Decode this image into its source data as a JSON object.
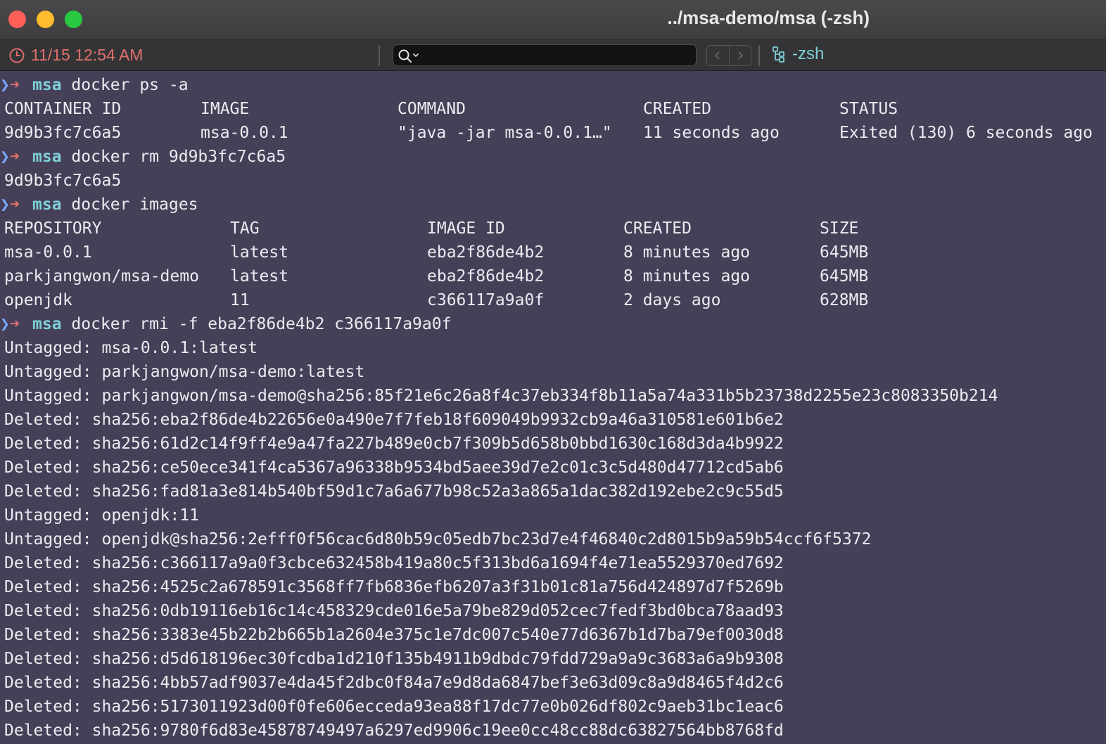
{
  "window": {
    "title": "../msa-demo/msa (-zsh)"
  },
  "toolbar": {
    "timestamp": "11/15 12:54 AM",
    "search_value": "",
    "session_label": "-zsh",
    "icons": {
      "clock": "clock-icon",
      "search": "magnifier-icon",
      "back": "chevron-left-icon",
      "forward": "chevron-right-icon",
      "session": "tree-icon"
    }
  },
  "colors": {
    "background": "#453f57",
    "prompt_dir": "#7fd0da",
    "timestamp": "#e0706c"
  },
  "terminal": {
    "prompt_dir": "msa",
    "cmd1": "docker ps -a",
    "ps_headers": [
      "CONTAINER ID",
      "IMAGE",
      "COMMAND",
      "CREATED",
      "STATUS"
    ],
    "ps_rows": [
      [
        "9d9b3fc7c6a5",
        "msa-0.0.1",
        "\"java -jar msa-0.0.1…\"",
        "11 seconds ago",
        "Exited (130) 6 seconds ago"
      ]
    ],
    "cmd2": "docker rm 9d9b3fc7c6a5",
    "rm_output": "9d9b3fc7c6a5",
    "cmd3": "docker images",
    "img_headers": [
      "REPOSITORY",
      "TAG",
      "IMAGE ID",
      "CREATED",
      "SIZE"
    ],
    "img_rows": [
      [
        "msa-0.0.1",
        "latest",
        "eba2f86de4b2",
        "8 minutes ago",
        "645MB"
      ],
      [
        "parkjangwon/msa-demo",
        "latest",
        "eba2f86de4b2",
        "8 minutes ago",
        "645MB"
      ],
      [
        "openjdk",
        "11",
        "c366117a9a0f",
        "2 days ago",
        "628MB"
      ]
    ],
    "cmd4": "docker rmi -f eba2f86de4b2 c366117a9a0f",
    "rmi_output": [
      "Untagged: msa-0.0.1:latest",
      "Untagged: parkjangwon/msa-demo:latest",
      "Untagged: parkjangwon/msa-demo@sha256:85f21e6c26a8f4c37eb334f8b11a5a74a331b5b23738d2255e23c8083350b214",
      "Deleted: sha256:eba2f86de4b22656e0a490e7f7feb18f609049b9932cb9a46a310581e601b6e2",
      "Deleted: sha256:61d2c14f9ff4e9a47fa227b489e0cb7f309b5d658b0bbd1630c168d3da4b9922",
      "Deleted: sha256:ce50ece341f4ca5367a96338b9534bd5aee39d7e2c01c3c5d480d47712cd5ab6",
      "Deleted: sha256:fad81a3e814b540bf59d1c7a6a677b98c52a3a865a1dac382d192ebe2c9c55d5",
      "Untagged: openjdk:11",
      "Untagged: openjdk@sha256:2efff0f56cac6d80b59c05edb7bc23d7e4f46840c2d8015b9a59b54ccf6f5372",
      "Deleted: sha256:c366117a9a0f3cbce632458b419a80c5f313bd6a1694f4e71ea5529370ed7692",
      "Deleted: sha256:4525c2a678591c3568ff7fb6836efb6207a3f31b01c81a756d424897d7f5269b",
      "Deleted: sha256:0db19116eb16c14c458329cde016e5a79be829d052cec7fedf3bd0bca78aad93",
      "Deleted: sha256:3383e45b22b2b665b1a2604e375c1e7dc007c540e77d6367b1d7ba79ef0030d8",
      "Deleted: sha256:d5d618196ec30fcdba1d210f135b4911b9dbdc79fdd729a9a9c3683a6a9b9308",
      "Deleted: sha256:4bb57adf9037e4da45f2dbc0f84a7e9d8da6847bef3e63d09c8a9d8465f4d2c6",
      "Deleted: sha256:5173011923d00f0fe606ecceda93ea88f17dc77e0b026df802c9aeb31bc1eac6",
      "Deleted: sha256:9780f6d83e45878749497a6297ed9906c19ee0cc48cc88dc63827564bb8768fd"
    ]
  }
}
